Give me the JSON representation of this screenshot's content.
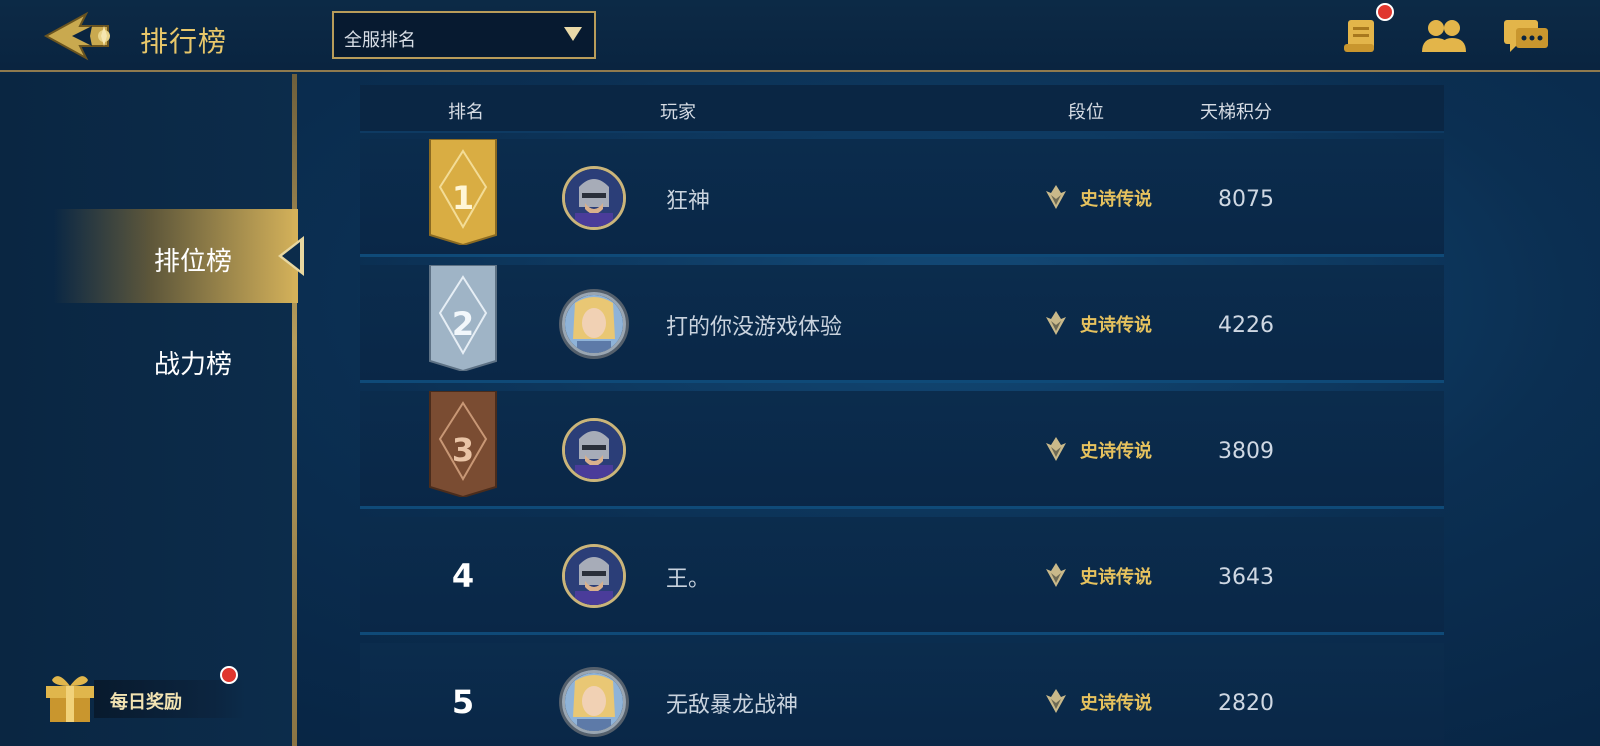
{
  "header": {
    "title": "排行榜",
    "dropdown_selected": "全服排名",
    "icons": [
      "scroll-icon",
      "friends-icon",
      "chat-icon"
    ]
  },
  "sidebar": {
    "tabs": [
      {
        "label": "排位榜",
        "active": true
      },
      {
        "label": "战力榜",
        "active": false
      }
    ],
    "daily_reward": "每日奖励"
  },
  "table": {
    "columns": [
      "排名",
      "玩家",
      "段位",
      "天梯积分"
    ],
    "rows": [
      {
        "rank": "1",
        "player": "狂神",
        "tier": "史诗传说",
        "score": "8075",
        "badge": "gold",
        "avatar": "knight"
      },
      {
        "rank": "2",
        "player": "打的你没游戏体验",
        "tier": "史诗传说",
        "score": "4226",
        "badge": "silver",
        "avatar": "elf"
      },
      {
        "rank": "3",
        "player": "",
        "tier": "史诗传说",
        "score": "3809",
        "badge": "bronze",
        "avatar": "knight"
      },
      {
        "rank": "4",
        "player": "王。",
        "tier": "史诗传说",
        "score": "3643",
        "badge": "none",
        "avatar": "knight"
      },
      {
        "rank": "5",
        "player": "无敌暴龙战神",
        "tier": "史诗传说",
        "score": "2820",
        "badge": "none",
        "avatar": "elf"
      }
    ]
  },
  "colors": {
    "gold_accent": "#e8c76a",
    "tier_text": "#e6c25e",
    "notification": "#e0362e"
  }
}
